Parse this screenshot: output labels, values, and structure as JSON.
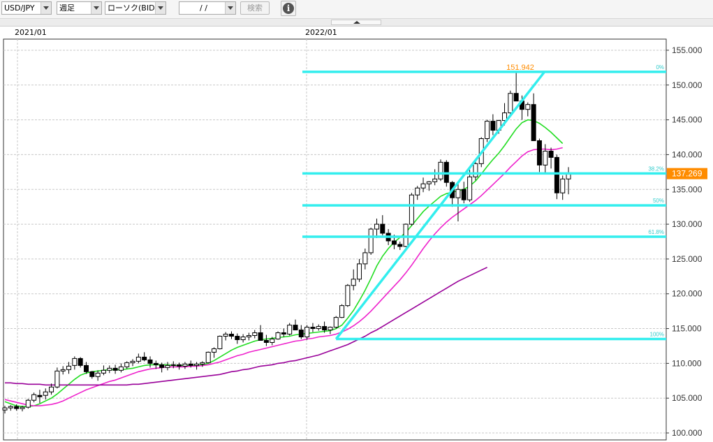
{
  "toolbar": {
    "symbol": "USD/JPY",
    "period": "週足",
    "chart_kind": "ローソク(BID)",
    "date_value": "/ /",
    "search_label": "検索",
    "info_glyph": "i"
  },
  "colors": {
    "up_body": "#ffffff",
    "down_body": "#000000",
    "ma_short": "#22dd22",
    "ma_mid": "#ee22cc",
    "ma_long": "#990099",
    "fibo": "#33eeee",
    "current_price_tag": "#ff8c00",
    "high_label": "#ff8c00"
  },
  "chart_data": {
    "type": "candlestick",
    "symbol": "USD/JPY",
    "timeframe": "週足",
    "x_labels": [
      "2021/01",
      "2022/01"
    ],
    "y_ticks": [
      "100.000",
      "105.000",
      "110.000",
      "115.000",
      "120.000",
      "125.000",
      "130.000",
      "135.000",
      "140.000",
      "145.000",
      "150.000",
      "155.000"
    ],
    "ylim": [
      99,
      156.6
    ],
    "current_price": 137.269,
    "current_price_label": "137.269",
    "high_label": "151.942",
    "fibonacci": {
      "start": {
        "week": 57,
        "price": 113.5
      },
      "end": {
        "week": 96,
        "price": 151.9
      },
      "levels": [
        {
          "label": "0%",
          "price": 151.9
        },
        {
          "label": "38.2%",
          "price": 137.3
        },
        {
          "label": "50%",
          "price": 132.7
        },
        {
          "label": "61.8%",
          "price": 128.2
        },
        {
          "label": "100%",
          "price": 113.5
        }
      ]
    },
    "candles": [
      [
        103.3,
        103.9,
        102.8,
        103.6
      ],
      [
        103.6,
        104.0,
        103.2,
        103.8
      ],
      [
        103.8,
        104.1,
        103.2,
        103.5
      ],
      [
        103.5,
        103.9,
        103.1,
        103.7
      ],
      [
        103.7,
        104.9,
        103.5,
        104.7
      ],
      [
        104.7,
        105.8,
        104.4,
        105.5
      ],
      [
        105.4,
        106.2,
        104.3,
        105.2
      ],
      [
        105.4,
        106.4,
        104.8,
        105.9
      ],
      [
        105.9,
        107.1,
        105.5,
        106.6
      ],
      [
        106.6,
        109.4,
        106.4,
        108.9
      ],
      [
        108.9,
        109.6,
        108.4,
        109.1
      ],
      [
        109.1,
        110.2,
        108.5,
        109.6
      ],
      [
        109.7,
        111.0,
        109.1,
        110.7
      ],
      [
        110.7,
        110.9,
        109.4,
        109.7
      ],
      [
        109.7,
        110.2,
        108.5,
        108.8
      ],
      [
        108.8,
        108.9,
        107.8,
        108.1
      ],
      [
        108.1,
        109.0,
        107.5,
        108.6
      ],
      [
        108.6,
        109.7,
        108.3,
        109.0
      ],
      [
        109.0,
        109.7,
        108.6,
        109.3
      ],
      [
        109.3,
        109.8,
        108.5,
        109.0
      ],
      [
        109.0,
        110.0,
        108.7,
        109.5
      ],
      [
        109.5,
        110.3,
        109.2,
        110.1
      ],
      [
        110.1,
        110.6,
        109.6,
        110.3
      ],
      [
        110.3,
        111.4,
        110.0,
        110.9
      ],
      [
        110.9,
        111.6,
        110.3,
        110.5
      ],
      [
        110.5,
        111.0,
        109.4,
        110.0
      ],
      [
        110.0,
        110.4,
        109.2,
        109.8
      ],
      [
        109.8,
        110.1,
        108.7,
        109.4
      ],
      [
        109.4,
        110.2,
        109.0,
        109.7
      ],
      [
        109.7,
        110.3,
        109.3,
        109.8
      ],
      [
        109.8,
        110.1,
        109.1,
        109.6
      ],
      [
        109.6,
        110.2,
        109.2,
        109.9
      ],
      [
        109.9,
        110.4,
        109.4,
        109.7
      ],
      [
        109.7,
        110.2,
        109.1,
        109.9
      ],
      [
        109.9,
        110.3,
        109.5,
        110.1
      ],
      [
        110.1,
        111.7,
        110.0,
        111.6
      ],
      [
        111.6,
        112.3,
        110.8,
        112.1
      ],
      [
        112.1,
        114.0,
        112.0,
        113.9
      ],
      [
        113.9,
        114.5,
        113.3,
        114.2
      ],
      [
        114.2,
        114.6,
        113.5,
        113.9
      ],
      [
        113.9,
        114.3,
        112.8,
        113.4
      ],
      [
        113.4,
        114.2,
        113.0,
        113.8
      ],
      [
        113.8,
        114.4,
        113.3,
        114.0
      ],
      [
        114.0,
        114.8,
        113.6,
        114.4
      ],
      [
        114.4,
        115.5,
        114.0,
        113.3
      ],
      [
        113.3,
        114.1,
        112.5,
        113.0
      ],
      [
        113.0,
        113.8,
        112.6,
        113.5
      ],
      [
        113.5,
        114.6,
        113.4,
        114.4
      ],
      [
        114.4,
        115.0,
        113.8,
        114.2
      ],
      [
        114.2,
        115.8,
        114.0,
        115.5
      ],
      [
        115.5,
        116.3,
        114.8,
        114.8
      ],
      [
        114.8,
        115.5,
        113.5,
        113.8
      ],
      [
        113.8,
        115.5,
        113.4,
        115.2
      ],
      [
        115.2,
        115.8,
        114.5,
        115.0
      ],
      [
        115.0,
        115.6,
        114.7,
        115.3
      ],
      [
        115.3,
        116.0,
        114.4,
        114.8
      ],
      [
        114.8,
        115.3,
        114.2,
        115.2
      ],
      [
        115.2,
        116.8,
        115.0,
        116.6
      ],
      [
        116.6,
        118.5,
        116.5,
        118.3
      ],
      [
        118.3,
        121.4,
        118.1,
        121.2
      ],
      [
        121.2,
        123.5,
        120.5,
        122.1
      ],
      [
        122.1,
        125.0,
        121.7,
        124.3
      ],
      [
        124.3,
        126.5,
        123.5,
        125.9
      ],
      [
        125.9,
        129.5,
        125.6,
        129.3
      ],
      [
        129.3,
        130.8,
        128.0,
        130.0
      ],
      [
        130.0,
        131.3,
        128.4,
        128.7
      ],
      [
        128.7,
        129.3,
        127.0,
        127.6
      ],
      [
        127.6,
        128.5,
        126.4,
        127.1
      ],
      [
        127.1,
        127.5,
        126.3,
        126.8
      ],
      [
        126.8,
        130.1,
        126.7,
        130.0
      ],
      [
        130.0,
        134.5,
        129.8,
        134.2
      ],
      [
        134.2,
        135.5,
        133.5,
        135.2
      ],
      [
        135.2,
        136.7,
        134.6,
        135.8
      ],
      [
        135.8,
        136.2,
        134.8,
        136.1
      ],
      [
        136.1,
        137.9,
        135.6,
        136.5
      ],
      [
        136.5,
        139.3,
        136.2,
        138.9
      ],
      [
        138.9,
        139.2,
        135.4,
        136.0
      ],
      [
        136.0,
        136.2,
        132.5,
        133.8
      ],
      [
        133.8,
        135.8,
        130.4,
        135.0
      ],
      [
        135.0,
        136.1,
        133.0,
        133.5
      ],
      [
        133.5,
        137.8,
        133.2,
        136.8
      ],
      [
        136.8,
        139.0,
        136.3,
        138.7
      ],
      [
        138.7,
        142.5,
        138.2,
        142.3
      ],
      [
        142.3,
        145.0,
        141.8,
        144.8
      ],
      [
        144.8,
        145.8,
        142.8,
        143.5
      ],
      [
        143.5,
        145.0,
        143.0,
        144.9
      ],
      [
        144.9,
        147.4,
        144.2,
        146.0
      ],
      [
        146.0,
        149.2,
        145.8,
        148.8
      ],
      [
        148.8,
        151.9,
        148.0,
        147.7
      ],
      [
        147.7,
        148.5,
        145.0,
        146.5
      ],
      [
        146.5,
        147.5,
        145.5,
        147.2
      ],
      [
        147.2,
        148.8,
        142.5,
        142.0
      ],
      [
        142.0,
        142.3,
        137.5,
        138.5
      ],
      [
        138.5,
        141.5,
        137.4,
        140.5
      ],
      [
        140.5,
        141.0,
        138.0,
        139.6
      ],
      [
        139.6,
        140.0,
        133.6,
        134.5
      ],
      [
        134.5,
        137.0,
        133.5,
        136.5
      ],
      [
        136.5,
        138.2,
        134.3,
        137.3
      ]
    ],
    "series": [
      {
        "color": "ma_short",
        "values": [
          104.5,
          104.2,
          103.9,
          103.8,
          103.8,
          103.9,
          104.2,
          104.6,
          105.0,
          105.6,
          106.3,
          107.0,
          107.7,
          108.3,
          108.6,
          108.8,
          108.9,
          109.0,
          109.1,
          109.1,
          109.1,
          109.2,
          109.3,
          109.5,
          109.7,
          109.8,
          109.8,
          109.8,
          109.8,
          109.7,
          109.7,
          109.7,
          109.7,
          109.8,
          109.8,
          110.0,
          110.4,
          110.9,
          111.4,
          111.9,
          112.3,
          112.6,
          112.9,
          113.2,
          113.4,
          113.5,
          113.6,
          113.7,
          113.8,
          113.9,
          114.1,
          114.2,
          114.3,
          114.4,
          114.5,
          114.6,
          114.7,
          115.0,
          115.5,
          116.5,
          117.6,
          119.0,
          120.5,
          122.2,
          124.0,
          125.4,
          126.5,
          127.4,
          128.1,
          128.8,
          129.8,
          130.8,
          131.8,
          132.6,
          133.3,
          134.0,
          134.4,
          134.6,
          134.8,
          135.0,
          135.5,
          136.2,
          137.2,
          138.3,
          139.3,
          140.2,
          141.3,
          142.5,
          143.7,
          144.6,
          145.0,
          144.9,
          144.5,
          143.9,
          143.2,
          142.4,
          141.6
        ]
      },
      {
        "color": "ma_mid",
        "values": [
          104.8,
          104.6,
          104.4,
          104.2,
          104.0,
          103.9,
          103.9,
          104.0,
          104.1,
          104.3,
          104.6,
          105.0,
          105.4,
          105.8,
          106.2,
          106.5,
          106.8,
          107.1,
          107.4,
          107.6,
          107.9,
          108.2,
          108.5,
          108.8,
          109.0,
          109.2,
          109.3,
          109.4,
          109.5,
          109.5,
          109.5,
          109.5,
          109.6,
          109.6,
          109.7,
          109.8,
          110.0,
          110.2,
          110.5,
          110.8,
          111.1,
          111.3,
          111.6,
          111.8,
          112.0,
          112.2,
          112.4,
          112.6,
          112.8,
          113.0,
          113.2,
          113.3,
          113.5,
          113.6,
          113.8,
          113.9,
          114.0,
          114.2,
          114.5,
          114.9,
          115.4,
          116.0,
          116.7,
          117.5,
          118.4,
          119.3,
          120.2,
          121.1,
          122.0,
          123.0,
          124.1,
          125.3,
          126.5,
          127.6,
          128.6,
          129.5,
          130.3,
          131.0,
          131.6,
          132.2,
          132.8,
          133.4,
          134.1,
          134.9,
          135.7,
          136.5,
          137.3,
          138.2,
          139.0,
          139.8,
          140.4,
          140.7,
          140.8,
          140.8,
          140.7,
          140.8,
          141.0
        ]
      },
      {
        "color": "ma_long",
        "values": [
          107.2,
          107.2,
          107.1,
          107.1,
          107.0,
          107.0,
          107.0,
          106.9,
          106.9,
          106.9,
          106.9,
          106.9,
          106.9,
          106.9,
          106.9,
          106.9,
          106.9,
          106.9,
          106.9,
          106.9,
          106.9,
          106.9,
          107.0,
          107.0,
          107.1,
          107.2,
          107.3,
          107.4,
          107.5,
          107.6,
          107.7,
          107.8,
          107.9,
          108.0,
          108.1,
          108.2,
          108.3,
          108.4,
          108.6,
          108.8,
          108.9,
          109.1,
          109.2,
          109.4,
          109.6,
          109.7,
          109.8,
          110.0,
          110.1,
          110.3,
          110.4,
          110.6,
          110.8,
          111.0,
          111.2,
          111.5,
          111.8,
          112.1,
          112.4,
          112.7,
          113.1,
          113.5,
          113.9,
          114.4,
          114.8,
          115.3,
          115.8,
          116.3,
          116.8,
          117.3,
          117.8,
          118.3,
          118.8,
          119.3,
          119.8,
          120.3,
          120.8,
          121.3,
          121.8,
          122.2,
          122.6,
          123.0,
          123.4,
          123.8
        ]
      }
    ]
  }
}
